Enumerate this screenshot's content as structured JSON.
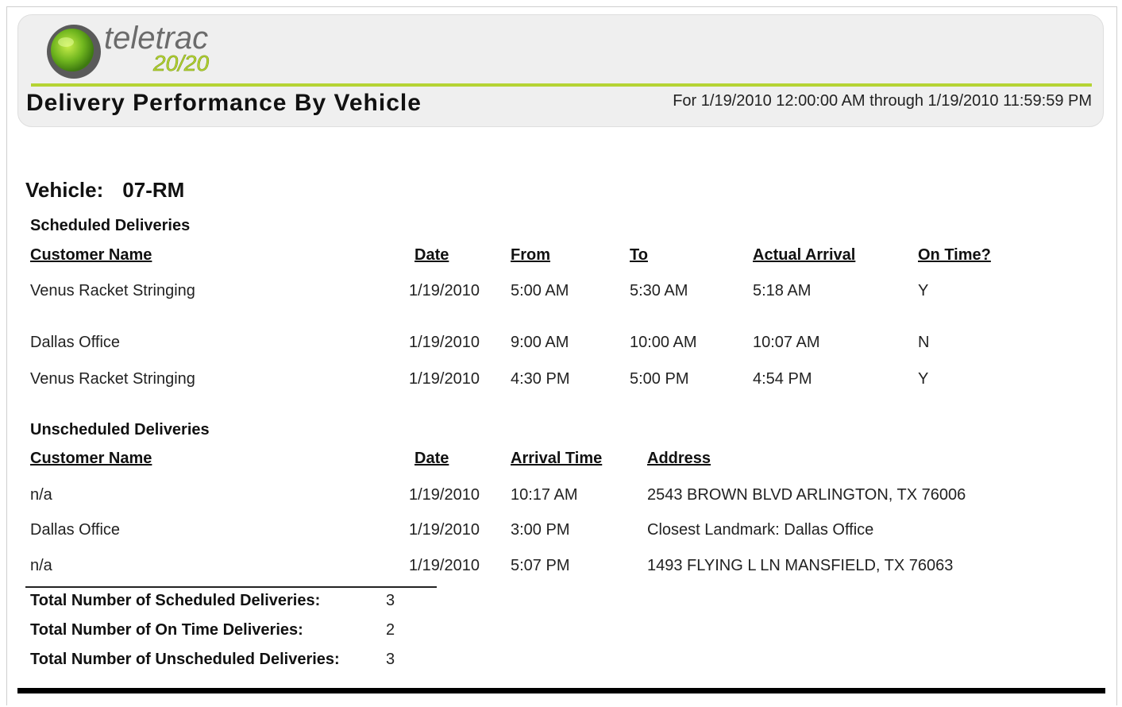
{
  "header": {
    "logo_text": "teletrac",
    "logo_sub": "20/20",
    "title": "Delivery Performance By Vehicle",
    "date_range": "For 1/19/2010 12:00:00 AM through 1/19/2010 11:59:59 PM"
  },
  "vehicle": {
    "label": "Vehicle:",
    "value": "07-RM"
  },
  "scheduled": {
    "label": "Scheduled Deliveries",
    "headers": [
      "Customer Name",
      "Date",
      "From",
      "To",
      "Actual Arrival",
      "On Time?"
    ],
    "rows": [
      [
        "Venus Racket Stringing",
        "1/19/2010",
        "5:00 AM",
        "5:30 AM",
        "5:18 AM",
        "Y"
      ],
      [
        "Dallas Office",
        "1/19/2010",
        "9:00 AM",
        "10:00 AM",
        "10:07 AM",
        "N"
      ],
      [
        "Venus Racket Stringing",
        "1/19/2010",
        "4:30 PM",
        "5:00 PM",
        "4:54 PM",
        "Y"
      ]
    ]
  },
  "unscheduled": {
    "label": "Unscheduled Deliveries",
    "headers": [
      "Customer Name",
      "Date",
      "Arrival Time",
      "Address"
    ],
    "rows": [
      [
        "n/a",
        "1/19/2010",
        "10:17 AM",
        "2543 BROWN BLVD ARLINGTON, TX 76006"
      ],
      [
        "Dallas Office",
        "1/19/2010",
        "3:00 PM",
        "Closest Landmark: Dallas Office"
      ],
      [
        "n/a",
        "1/19/2010",
        "5:07 PM",
        "1493 FLYING L LN MANSFIELD, TX 76063"
      ]
    ]
  },
  "totals": [
    {
      "label": "Total Number of Scheduled Deliveries:",
      "value": "3"
    },
    {
      "label": "Total Number of On Time Deliveries:",
      "value": "2"
    },
    {
      "label": "Total Number of Unscheduled Deliveries:",
      "value": "3"
    }
  ],
  "colors": {
    "accent_green": "#b5d334",
    "header_bg": "#efefef"
  }
}
